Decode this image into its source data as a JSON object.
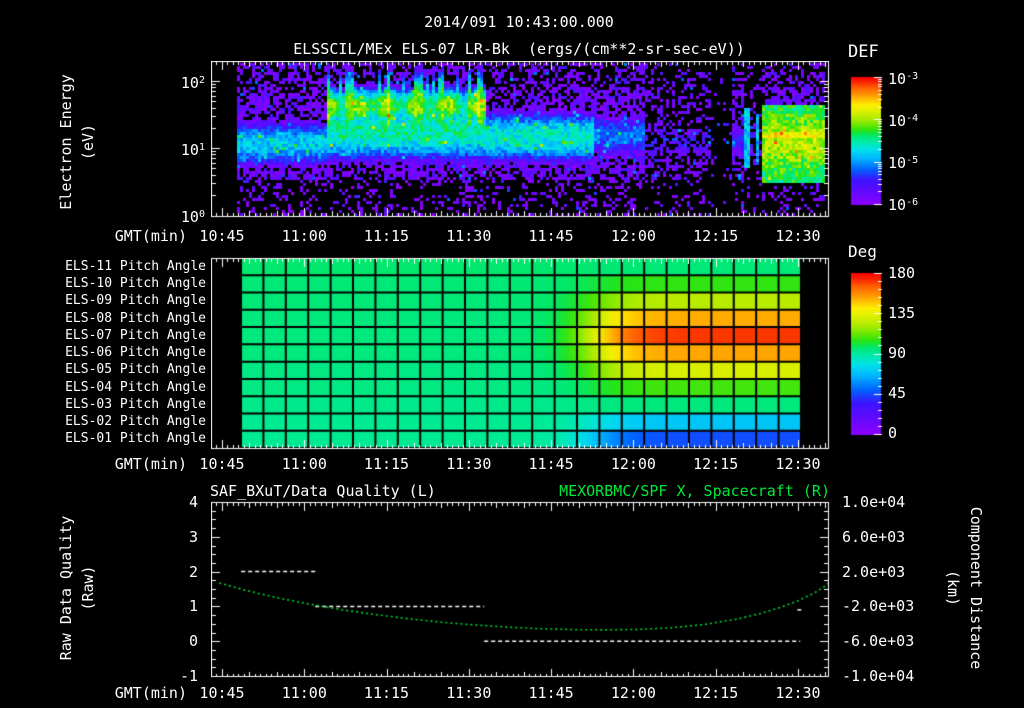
{
  "header": {
    "timestamp": "2014/091 10:43:00.000",
    "subtitle": "ELSSCIL/MEx ELS-07 LR-Bk  (ergs/(cm**2-sr-sec-eV))"
  },
  "time_axis": {
    "label": "GMT(min)",
    "tick_labels": [
      "10:45",
      "11:00",
      "11:15",
      "11:30",
      "11:45",
      "12:00",
      "12:15",
      "12:30"
    ]
  },
  "spectrogram_panel": {
    "y_axis_label_line1": "Electron Energy",
    "y_axis_label_line2": "(eV)",
    "y_tick_labels": [
      {
        "base": "10",
        "exp": "2"
      },
      {
        "base": "10",
        "exp": "1"
      },
      {
        "base": "10",
        "exp": "0"
      }
    ],
    "colorbar_title": "DEF",
    "colorbar_tick_labels": [
      {
        "base": "10",
        "exp": "-3"
      },
      {
        "base": "10",
        "exp": "-4"
      },
      {
        "base": "10",
        "exp": "-5"
      },
      {
        "base": "10",
        "exp": "-6"
      }
    ]
  },
  "pitch_panel": {
    "row_labels": [
      "ELS-11 Pitch Angle",
      "ELS-10 Pitch Angle",
      "ELS-09 Pitch Angle",
      "ELS-08 Pitch Angle",
      "ELS-07 Pitch Angle",
      "ELS-06 Pitch Angle",
      "ELS-05 Pitch Angle",
      "ELS-04 Pitch Angle",
      "ELS-03 Pitch Angle",
      "ELS-02 Pitch Angle",
      "ELS-01 Pitch Angle"
    ],
    "colorbar_title": "Deg",
    "colorbar_tick_labels": [
      "180",
      "135",
      "90",
      "45",
      "0"
    ]
  },
  "line_panel": {
    "title_left": "SAF_BXuT/Data Quality (L)",
    "title_right": "MEXORBMC/SPF X, Spacecraft (R)",
    "y_axis_left_line1": "Raw Data Quality",
    "y_axis_left_line2": "(Raw)",
    "y_axis_right_line1": "Component Distance",
    "y_axis_right_line2": "(km)",
    "y_tick_labels_left": [
      "4",
      "3",
      "2",
      "1",
      "0",
      "-1"
    ],
    "y_tick_labels_right": [
      "1.0e+04",
      "6.0e+03",
      "2.0e+03",
      "-2.0e+03",
      "-6.0e+03",
      "-1.0e+04"
    ]
  },
  "colors": {
    "text": "#ffffff",
    "background": "#000000",
    "title_green": "#00e839",
    "curve_green": "#00d42e",
    "quality_white": "#ffffff"
  },
  "chart_data": [
    {
      "type": "heatmap",
      "subtype": "spectrogram",
      "title": "ELSSCIL/MEx ELS-07 LR-Bk",
      "units": "ergs/(cm**2-sr-sec-eV)",
      "xlabel": "GMT(min)",
      "ylabel": "Electron Energy (eV)",
      "x_range_min": [
        0,
        112.7
      ],
      "y_log10_ev_range": [
        0,
        2.3
      ],
      "z_log10_range": [
        -6,
        -3
      ],
      "data_start_min": 4.6,
      "data_end_min": 112.4,
      "background": {
        "level": -5.62,
        "noise": 0.55,
        "top_logE": 1.92,
        "top_black": 0.32,
        "bottom_logE": 0.52,
        "bottom_black": 0.5,
        "mid_black": 0.06
      },
      "core_band": [
        {
          "t": [
            4.6,
            21
          ],
          "peak": -4.8,
          "center": 1.06,
          "width": 0.3
        },
        {
          "t": [
            21,
            50
          ],
          "peak": -4.5,
          "center": 1.26,
          "width": 0.4
        },
        {
          "t": [
            50,
            70
          ],
          "peak": -4.62,
          "center": 1.16,
          "width": 0.34
        },
        {
          "t": [
            70,
            79
          ],
          "peak": -5.1,
          "center": 1.18,
          "width": 0.3
        },
        {
          "t": [
            79,
            100.4
          ],
          "peak": -5.45,
          "center": 1.1,
          "width": 0.26
        }
      ],
      "high_band": {
        "t": [
          21,
          50
        ],
        "peak": -4.0,
        "center": 1.62,
        "width": 0.23
      },
      "sparse_regions": [
        {
          "t": [
            79,
            91
          ],
          "black": 0.45
        },
        {
          "t": [
            91,
            95.2
          ],
          "black": 0.9
        },
        {
          "t": [
            97.4,
            100.4
          ],
          "black": 0.55
        }
      ],
      "streaks": [
        {
          "t": 97.7,
          "halfwidth": 0.45,
          "logE": [
            0.7,
            1.6
          ],
          "level": -4.8
        },
        {
          "t": 99.7,
          "halfwidth": 0.35,
          "logE": [
            0.8,
            1.5
          ],
          "level": -5.0
        }
      ],
      "green_block": {
        "t": [
          100.4,
          112.4
        ],
        "logE": [
          0.5,
          1.62
        ],
        "level": -4.45,
        "core_center": 1.1,
        "core_width": 0.42,
        "core_boost": 0.5,
        "stripe_logE": 1.18,
        "stripe_halfwidth": 0.05,
        "stripe_boost": 0.22
      }
    },
    {
      "type": "heatmap",
      "subtype": "pitch-angle-grid",
      "value_units": "deg",
      "value_range": [
        0,
        180
      ],
      "columns": 25,
      "col_start_min": 5.47,
      "col_width_min": 4.083,
      "transition": {
        "center_min": 70,
        "width_min": 3
      },
      "rows": [
        {
          "label": "ELS-11 Pitch Angle",
          "left_deg": 97,
          "right_deg": 96
        },
        {
          "label": "ELS-10 Pitch Angle",
          "left_deg": 96,
          "right_deg": 106
        },
        {
          "label": "ELS-09 Pitch Angle",
          "left_deg": 96,
          "right_deg": 124
        },
        {
          "label": "ELS-08 Pitch Angle",
          "left_deg": 95,
          "right_deg": 152
        },
        {
          "label": "ELS-07 Pitch Angle",
          "left_deg": 95,
          "right_deg": 171
        },
        {
          "label": "ELS-06 Pitch Angle",
          "left_deg": 95,
          "right_deg": 153
        },
        {
          "label": "ELS-05 Pitch Angle",
          "left_deg": 94,
          "right_deg": 131
        },
        {
          "label": "ELS-04 Pitch Angle",
          "left_deg": 94,
          "right_deg": 108
        },
        {
          "label": "ELS-03 Pitch Angle",
          "left_deg": 93,
          "right_deg": 95
        },
        {
          "label": "ELS-02 Pitch Angle",
          "left_deg": 92,
          "right_deg": 70
        },
        {
          "label": "ELS-01 Pitch Angle",
          "left_deg": 92,
          "right_deg": 46
        }
      ]
    },
    {
      "type": "line",
      "ylim_left": [
        -1,
        4
      ],
      "ylim_right": [
        -10000,
        10000
      ],
      "series": [
        {
          "name": "SAF_BXuT/Data Quality (L)",
          "axis": "left",
          "style": "dashed",
          "color": "#ffffff",
          "segments": [
            {
              "t0": 5.5,
              "t1": 19.0,
              "value": 2
            },
            {
              "t0": 19.0,
              "t1": 49.8,
              "value": 1
            },
            {
              "t0": 49.8,
              "t1": 107.4,
              "value": 0
            },
            {
              "t0": 106.9,
              "t1": 107.6,
              "value": 0.9
            }
          ]
        },
        {
          "name": "MEXORBMC/SPF X, Spacecraft (R)",
          "axis": "right",
          "style": "dotted",
          "color": "#00d42e",
          "points": [
            [
              1.5,
              700
            ],
            [
              6,
              -100
            ],
            [
              12,
              -1000
            ],
            [
              18,
              -1750
            ],
            [
              24,
              -2400
            ],
            [
              30,
              -2950
            ],
            [
              36,
              -3420
            ],
            [
              42,
              -3820
            ],
            [
              48,
              -4130
            ],
            [
              54,
              -4380
            ],
            [
              60,
              -4560
            ],
            [
              66,
              -4670
            ],
            [
              72,
              -4700
            ],
            [
              78,
              -4640
            ],
            [
              84,
              -4450
            ],
            [
              90,
              -4070
            ],
            [
              96,
              -3440
            ],
            [
              100,
              -2850
            ],
            [
              104,
              -2080
            ],
            [
              107,
              -1350
            ],
            [
              110,
              -450
            ],
            [
              112,
              350
            ],
            [
              112.6,
              700
            ]
          ]
        }
      ]
    }
  ]
}
